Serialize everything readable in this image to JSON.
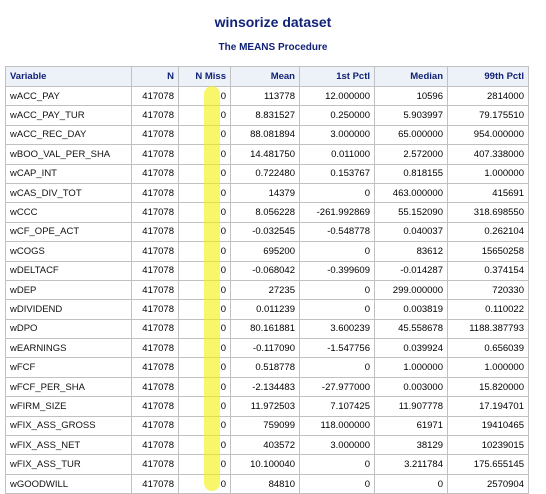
{
  "title": "winsorize dataset",
  "subtitle": "The MEANS Procedure",
  "headers": [
    "Variable",
    "N",
    "N Miss",
    "Mean",
    "1st Pctl",
    "Median",
    "99th Pctl"
  ],
  "rows": [
    [
      "wACC_PAY",
      "417078",
      "0",
      "113778",
      "12.000000",
      "10596",
      "2814000"
    ],
    [
      "wACC_PAY_TUR",
      "417078",
      "0",
      "8.831527",
      "0.250000",
      "5.903997",
      "79.175510"
    ],
    [
      "wACC_REC_DAY",
      "417078",
      "0",
      "88.081894",
      "3.000000",
      "65.000000",
      "954.000000"
    ],
    [
      "wBOO_VAL_PER_SHA",
      "417078",
      "0",
      "14.481750",
      "0.011000",
      "2.572000",
      "407.338000"
    ],
    [
      "wCAP_INT",
      "417078",
      "0",
      "0.722480",
      "0.153767",
      "0.818155",
      "1.000000"
    ],
    [
      "wCAS_DIV_TOT",
      "417078",
      "0",
      "14379",
      "0",
      "463.000000",
      "415691"
    ],
    [
      "wCCC",
      "417078",
      "0",
      "8.056228",
      "-261.992869",
      "55.152090",
      "318.698550"
    ],
    [
      "wCF_OPE_ACT",
      "417078",
      "0",
      "-0.032545",
      "-0.548778",
      "0.040037",
      "0.262104"
    ],
    [
      "wCOGS",
      "417078",
      "0",
      "695200",
      "0",
      "83612",
      "15650258"
    ],
    [
      "wDELTACF",
      "417078",
      "0",
      "-0.068042",
      "-0.399609",
      "-0.014287",
      "0.374154"
    ],
    [
      "wDEP",
      "417078",
      "0",
      "27235",
      "0",
      "299.000000",
      "720330"
    ],
    [
      "wDIVIDEND",
      "417078",
      "0",
      "0.011239",
      "0",
      "0.003819",
      "0.110022"
    ],
    [
      "wDPO",
      "417078",
      "0",
      "80.161881",
      "3.600239",
      "45.558678",
      "1188.387793"
    ],
    [
      "wEARNINGS",
      "417078",
      "0",
      "-0.117090",
      "-1.547756",
      "0.039924",
      "0.656039"
    ],
    [
      "wFCF",
      "417078",
      "0",
      "0.518778",
      "0",
      "1.000000",
      "1.000000"
    ],
    [
      "wFCF_PER_SHA",
      "417078",
      "0",
      "-2.134483",
      "-27.977000",
      "0.003000",
      "15.820000"
    ],
    [
      "wFIRM_SIZE",
      "417078",
      "0",
      "11.972503",
      "7.107425",
      "11.907778",
      "17.194701"
    ],
    [
      "wFIX_ASS_GROSS",
      "417078",
      "0",
      "759099",
      "118.000000",
      "61971",
      "19410465"
    ],
    [
      "wFIX_ASS_NET",
      "417078",
      "0",
      "403572",
      "3.000000",
      "38129",
      "10239015"
    ],
    [
      "wFIX_ASS_TUR",
      "417078",
      "0",
      "10.100040",
      "0",
      "3.211784",
      "175.655145"
    ],
    [
      "wGOODWILL",
      "417078",
      "0",
      "84810",
      "0",
      "0",
      "2570904"
    ]
  ]
}
